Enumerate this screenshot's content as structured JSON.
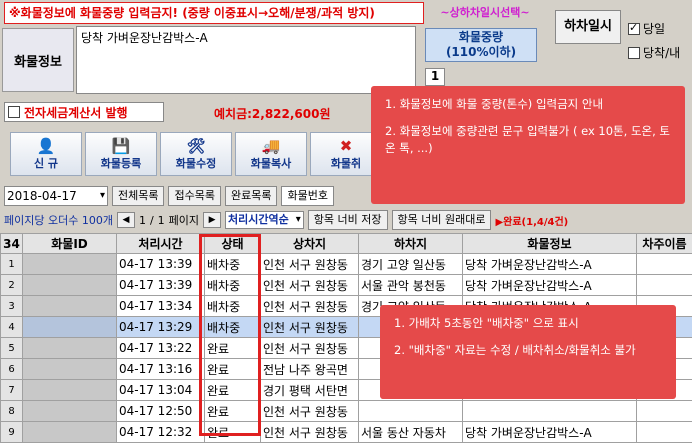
{
  "top": {
    "warning": "※화물정보에 화물중량 입력금지! (중량 이중표시→오해/분쟁/과적 방지)",
    "pick_header": "~상하차일시선택~",
    "weight_button": "화물중량\n(110%이하)",
    "weight_button_line1": "화물중량",
    "weight_button_line2": "(110%이하)",
    "unload_button": "하차일시",
    "checkbox_same_day": "당일",
    "checkbox_same_day_checked": true,
    "checkbox_unload": "당착/내",
    "unload_value": "1",
    "deposit": "예치금:2,822,600원"
  },
  "cargo": {
    "label": "화물정보",
    "text": "당착 가벼운장난감박스-A"
  },
  "tax": {
    "label": "전자세금계산서 발행",
    "checked": false
  },
  "toolbar": [
    {
      "icon": "person-icon",
      "glyph": "👤",
      "label": "신 규"
    },
    {
      "icon": "save-icon",
      "glyph": "💾",
      "label": "화물등록"
    },
    {
      "icon": "tools-icon",
      "glyph": "🛠",
      "label": "화물수정"
    },
    {
      "icon": "truck-icon",
      "glyph": "🚚",
      "label": "화물복사"
    },
    {
      "icon": "cancel-icon",
      "glyph": "✖",
      "label": "화물취"
    }
  ],
  "filters": {
    "date": "2018-04-17",
    "all_list": "전체목록",
    "accept_list": "접수목록",
    "done_list": "완료목록",
    "cargo_no_label": "화물번호"
  },
  "paging": {
    "per_page": "페이지당 오더수 100개",
    "current": "1",
    "total": "1",
    "page_word": "페이지",
    "sort": "처리시간역순",
    "width_save": "항목 너비 저장",
    "width_reset": "항목 너비",
    "restore": "원래대로",
    "done_summary": "▶완료(1,4/4건)"
  },
  "grid": {
    "corner": "34",
    "headers": [
      "화물ID",
      "처리시간",
      "상태",
      "상차지",
      "하차지",
      "화물정보",
      "차주이름"
    ],
    "rows": [
      {
        "n": "1",
        "time": "04-17 13:39",
        "status": "배차중",
        "load": "인천 서구 원창동",
        "unload": "경기 고양 일산동",
        "info": "당착 가벼운장난감박스-A",
        "selected": false
      },
      {
        "n": "2",
        "time": "04-17 13:39",
        "status": "배차중",
        "load": "인천 서구 원창동",
        "unload": "서울 관악 봉천동",
        "info": "당착 가벼운장난감박스-A",
        "selected": false
      },
      {
        "n": "3",
        "time": "04-17 13:34",
        "status": "배차중",
        "load": "인천 서구 원창동",
        "unload": "경기 고양 일산동",
        "info": "당착 가벼운장난감박스-A",
        "selected": false
      },
      {
        "n": "4",
        "time": "04-17 13:29",
        "status": "배차중",
        "load": "인천 서구 원창동",
        "unload": "",
        "info": "",
        "selected": true
      },
      {
        "n": "5",
        "time": "04-17 13:22",
        "status": "완료",
        "load": "인천 서구 원창동",
        "unload": "",
        "info": "",
        "selected": false
      },
      {
        "n": "6",
        "time": "04-17 13:16",
        "status": "완료",
        "load": "전남 나주 왕곡면",
        "unload": "",
        "info": "",
        "selected": false
      },
      {
        "n": "7",
        "time": "04-17 13:04",
        "status": "완료",
        "load": "경기 평택 서탄면",
        "unload": "",
        "info": "",
        "selected": false
      },
      {
        "n": "8",
        "time": "04-17 12:50",
        "status": "완료",
        "load": "인천 서구 원창동",
        "unload": "",
        "info": "",
        "selected": false
      },
      {
        "n": "9",
        "time": "04-17 12:32",
        "status": "완료",
        "load": "인천 서구 원창동",
        "unload": "서울 동산 자동차",
        "info": "당착 가벼운장난감박스-A",
        "selected": false
      }
    ]
  },
  "callouts": {
    "first": [
      "1. 화물정보에 화물 중량(톤수) 입력금지 안내",
      "2. 화물정보에 중량관련 문구 입력불가 ( ex 10톤, 도온, 토온 톡, ...)"
    ],
    "second": [
      "1. 가배차 5초동안 \"배차중\" 으로 표시",
      "2. \"배차중\" 자료는 수정 / 배차취소/화물취소 불가"
    ]
  },
  "colors": {
    "warning_red": "#e00000",
    "callout_bg": "#e54a4a",
    "selected_row": "#c4d8f4",
    "highlight_border": "#e02020"
  }
}
